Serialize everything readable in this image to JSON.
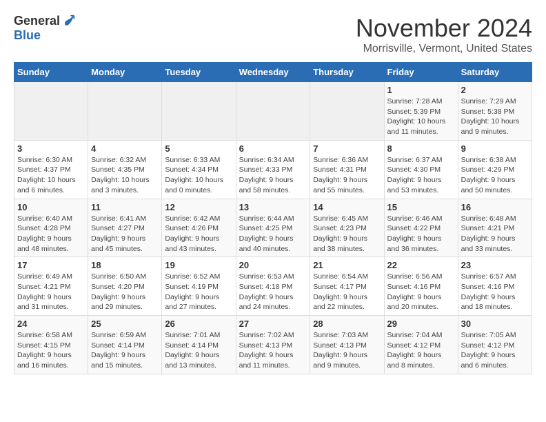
{
  "logo": {
    "general": "General",
    "blue": "Blue"
  },
  "title": "November 2024",
  "location": "Morrisville, Vermont, United States",
  "days_of_week": [
    "Sunday",
    "Monday",
    "Tuesday",
    "Wednesday",
    "Thursday",
    "Friday",
    "Saturday"
  ],
  "weeks": [
    [
      {
        "day": "",
        "info": ""
      },
      {
        "day": "",
        "info": ""
      },
      {
        "day": "",
        "info": ""
      },
      {
        "day": "",
        "info": ""
      },
      {
        "day": "",
        "info": ""
      },
      {
        "day": "1",
        "info": "Sunrise: 7:28 AM\nSunset: 5:39 PM\nDaylight: 10 hours and 11 minutes."
      },
      {
        "day": "2",
        "info": "Sunrise: 7:29 AM\nSunset: 5:38 PM\nDaylight: 10 hours and 9 minutes."
      }
    ],
    [
      {
        "day": "3",
        "info": "Sunrise: 6:30 AM\nSunset: 4:37 PM\nDaylight: 10 hours and 6 minutes."
      },
      {
        "day": "4",
        "info": "Sunrise: 6:32 AM\nSunset: 4:35 PM\nDaylight: 10 hours and 3 minutes."
      },
      {
        "day": "5",
        "info": "Sunrise: 6:33 AM\nSunset: 4:34 PM\nDaylight: 10 hours and 0 minutes."
      },
      {
        "day": "6",
        "info": "Sunrise: 6:34 AM\nSunset: 4:33 PM\nDaylight: 9 hours and 58 minutes."
      },
      {
        "day": "7",
        "info": "Sunrise: 6:36 AM\nSunset: 4:31 PM\nDaylight: 9 hours and 55 minutes."
      },
      {
        "day": "8",
        "info": "Sunrise: 6:37 AM\nSunset: 4:30 PM\nDaylight: 9 hours and 53 minutes."
      },
      {
        "day": "9",
        "info": "Sunrise: 6:38 AM\nSunset: 4:29 PM\nDaylight: 9 hours and 50 minutes."
      }
    ],
    [
      {
        "day": "10",
        "info": "Sunrise: 6:40 AM\nSunset: 4:28 PM\nDaylight: 9 hours and 48 minutes."
      },
      {
        "day": "11",
        "info": "Sunrise: 6:41 AM\nSunset: 4:27 PM\nDaylight: 9 hours and 45 minutes."
      },
      {
        "day": "12",
        "info": "Sunrise: 6:42 AM\nSunset: 4:26 PM\nDaylight: 9 hours and 43 minutes."
      },
      {
        "day": "13",
        "info": "Sunrise: 6:44 AM\nSunset: 4:25 PM\nDaylight: 9 hours and 40 minutes."
      },
      {
        "day": "14",
        "info": "Sunrise: 6:45 AM\nSunset: 4:23 PM\nDaylight: 9 hours and 38 minutes."
      },
      {
        "day": "15",
        "info": "Sunrise: 6:46 AM\nSunset: 4:22 PM\nDaylight: 9 hours and 36 minutes."
      },
      {
        "day": "16",
        "info": "Sunrise: 6:48 AM\nSunset: 4:21 PM\nDaylight: 9 hours and 33 minutes."
      }
    ],
    [
      {
        "day": "17",
        "info": "Sunrise: 6:49 AM\nSunset: 4:21 PM\nDaylight: 9 hours and 31 minutes."
      },
      {
        "day": "18",
        "info": "Sunrise: 6:50 AM\nSunset: 4:20 PM\nDaylight: 9 hours and 29 minutes."
      },
      {
        "day": "19",
        "info": "Sunrise: 6:52 AM\nSunset: 4:19 PM\nDaylight: 9 hours and 27 minutes."
      },
      {
        "day": "20",
        "info": "Sunrise: 6:53 AM\nSunset: 4:18 PM\nDaylight: 9 hours and 24 minutes."
      },
      {
        "day": "21",
        "info": "Sunrise: 6:54 AM\nSunset: 4:17 PM\nDaylight: 9 hours and 22 minutes."
      },
      {
        "day": "22",
        "info": "Sunrise: 6:56 AM\nSunset: 4:16 PM\nDaylight: 9 hours and 20 minutes."
      },
      {
        "day": "23",
        "info": "Sunrise: 6:57 AM\nSunset: 4:16 PM\nDaylight: 9 hours and 18 minutes."
      }
    ],
    [
      {
        "day": "24",
        "info": "Sunrise: 6:58 AM\nSunset: 4:15 PM\nDaylight: 9 hours and 16 minutes."
      },
      {
        "day": "25",
        "info": "Sunrise: 6:59 AM\nSunset: 4:14 PM\nDaylight: 9 hours and 15 minutes."
      },
      {
        "day": "26",
        "info": "Sunrise: 7:01 AM\nSunset: 4:14 PM\nDaylight: 9 hours and 13 minutes."
      },
      {
        "day": "27",
        "info": "Sunrise: 7:02 AM\nSunset: 4:13 PM\nDaylight: 9 hours and 11 minutes."
      },
      {
        "day": "28",
        "info": "Sunrise: 7:03 AM\nSunset: 4:13 PM\nDaylight: 9 hours and 9 minutes."
      },
      {
        "day": "29",
        "info": "Sunrise: 7:04 AM\nSunset: 4:12 PM\nDaylight: 9 hours and 8 minutes."
      },
      {
        "day": "30",
        "info": "Sunrise: 7:05 AM\nSunset: 4:12 PM\nDaylight: 9 hours and 6 minutes."
      }
    ]
  ]
}
